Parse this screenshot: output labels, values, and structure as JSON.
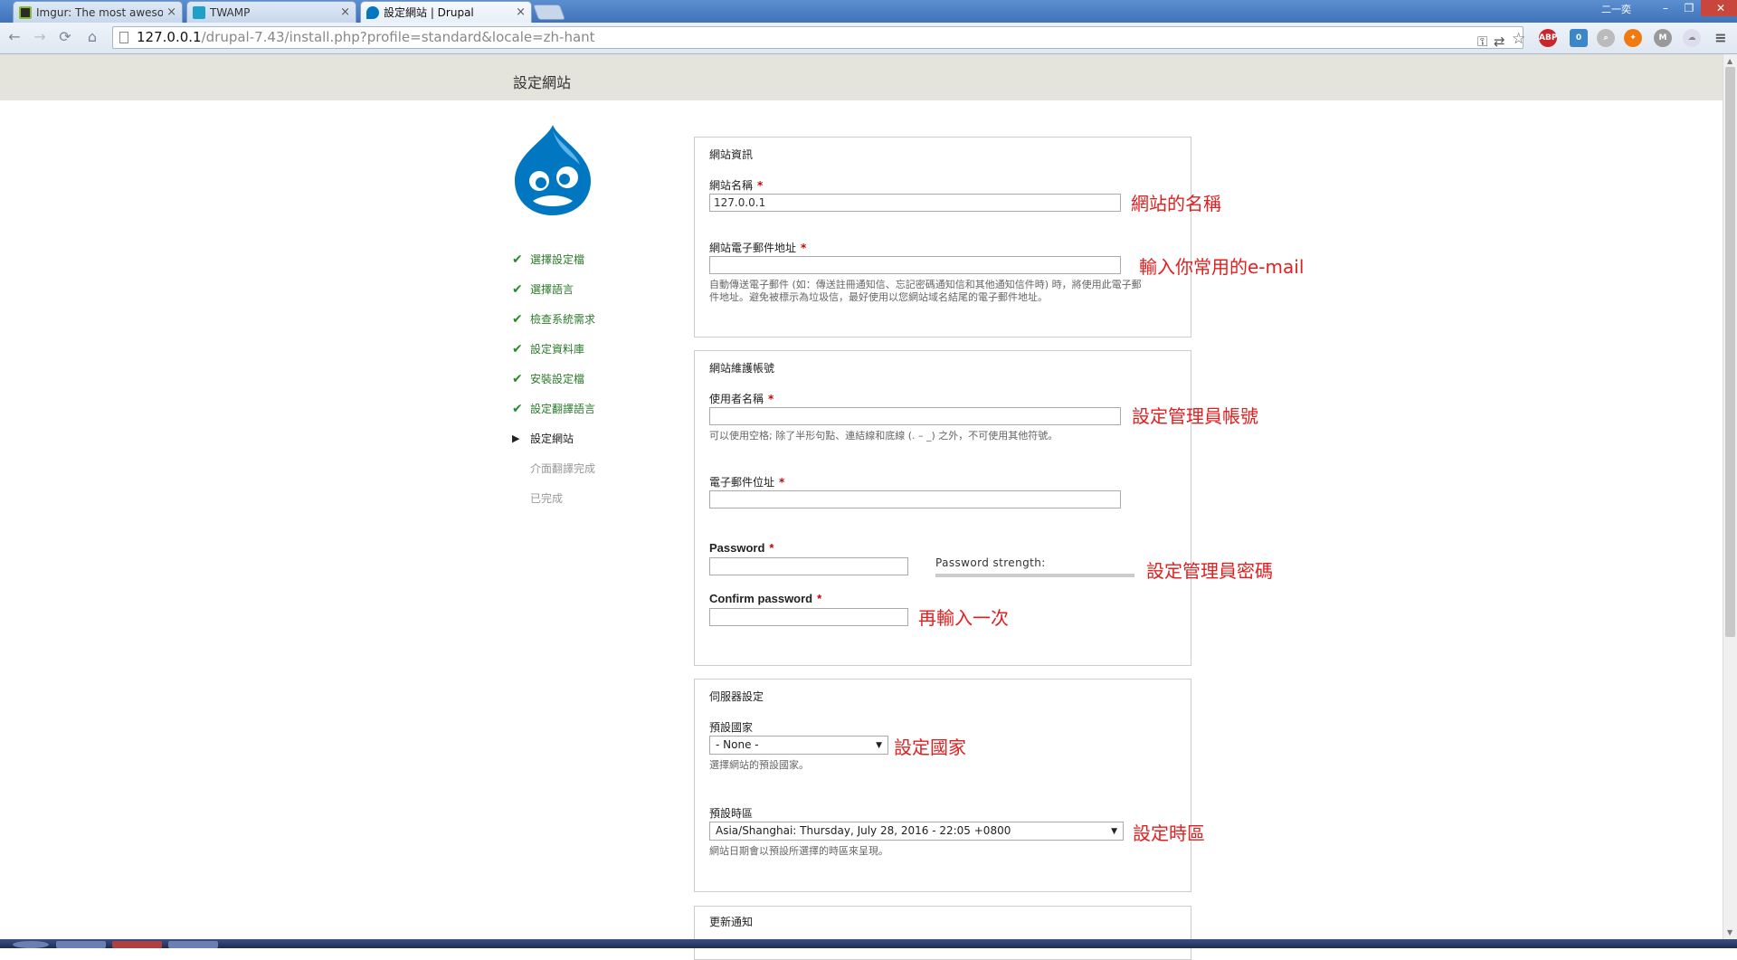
{
  "browser": {
    "tabs": [
      {
        "title": "Imgur: The most awesome images on the Internet",
        "close": "×"
      },
      {
        "title": "TWAMP",
        "close": "×"
      },
      {
        "title": "設定網站 | Drupal",
        "close": "×"
      }
    ],
    "url_host": "127.0.0.1",
    "url_path": "/drupal-7.43/install.php?profile=standard&locale=zh-hant",
    "window_controls": {
      "minimize": "–",
      "maximize": "❐",
      "close": "✕"
    },
    "user_label": "二一奕"
  },
  "page": {
    "title": "設定網站",
    "steps": [
      {
        "label": "選擇設定檔",
        "state": "done"
      },
      {
        "label": "選擇語言",
        "state": "done"
      },
      {
        "label": "檢查系統需求",
        "state": "done"
      },
      {
        "label": "設定資料庫",
        "state": "done"
      },
      {
        "label": "安裝設定檔",
        "state": "done"
      },
      {
        "label": "設定翻譯語言",
        "state": "done"
      },
      {
        "label": "設定網站",
        "state": "active"
      },
      {
        "label": "介面翻譯完成",
        "state": "todo"
      },
      {
        "label": "已完成",
        "state": "todo"
      }
    ],
    "site_info": {
      "legend": "網站資訊",
      "site_name_label": "網站名稱",
      "site_name_value": "127.0.0.1",
      "site_email_label": "網站電子郵件地址",
      "site_email_desc_1": "自動傳送電子郵件 (如：傳送註冊通知信、忘記密碼通知信和其他通知信件時) 時，將使用此電子郵",
      "site_email_desc_2": "件地址。避免被標示為垃圾信，最好使用以您網站域名結尾的電子郵件地址。"
    },
    "admin_account": {
      "legend": "網站維護帳號",
      "username_label": "使用者名稱",
      "username_desc": "可以使用空格; 除了半形句點、連結線和底線 (. – _) 之外，不可使用其他符號。",
      "email_label": "電子郵件位址",
      "password_label": "Password",
      "password_strength_label": "Password strength:",
      "confirm_label": "Confirm password"
    },
    "server_settings": {
      "legend": "伺服器設定",
      "country_label": "預設國家",
      "country_value": "- None -",
      "country_desc": "選擇網站的預設國家。",
      "timezone_label": "預設時區",
      "timezone_value": "Asia/Shanghai: Thursday, July 28, 2016 - 22:05 +0800",
      "timezone_desc": "網站日期會以預設所選擇的時區來呈現。"
    },
    "update_notifications": {
      "legend": "更新通知"
    },
    "required_marker": "*",
    "annotations": {
      "site_name": "網站的名稱",
      "site_email": "輸入你常用的e-mail",
      "username": "設定管理員帳號",
      "password": "設定管理員密碼",
      "confirm": "再輸入一次",
      "country": "設定國家",
      "timezone": "設定時區"
    }
  },
  "colors": {
    "header_bg": "#e4e3dc",
    "annotation": "#e02020",
    "done_step": "#2b7a2b",
    "required": "#cc0000",
    "drupal_blue": "#0077c0"
  }
}
